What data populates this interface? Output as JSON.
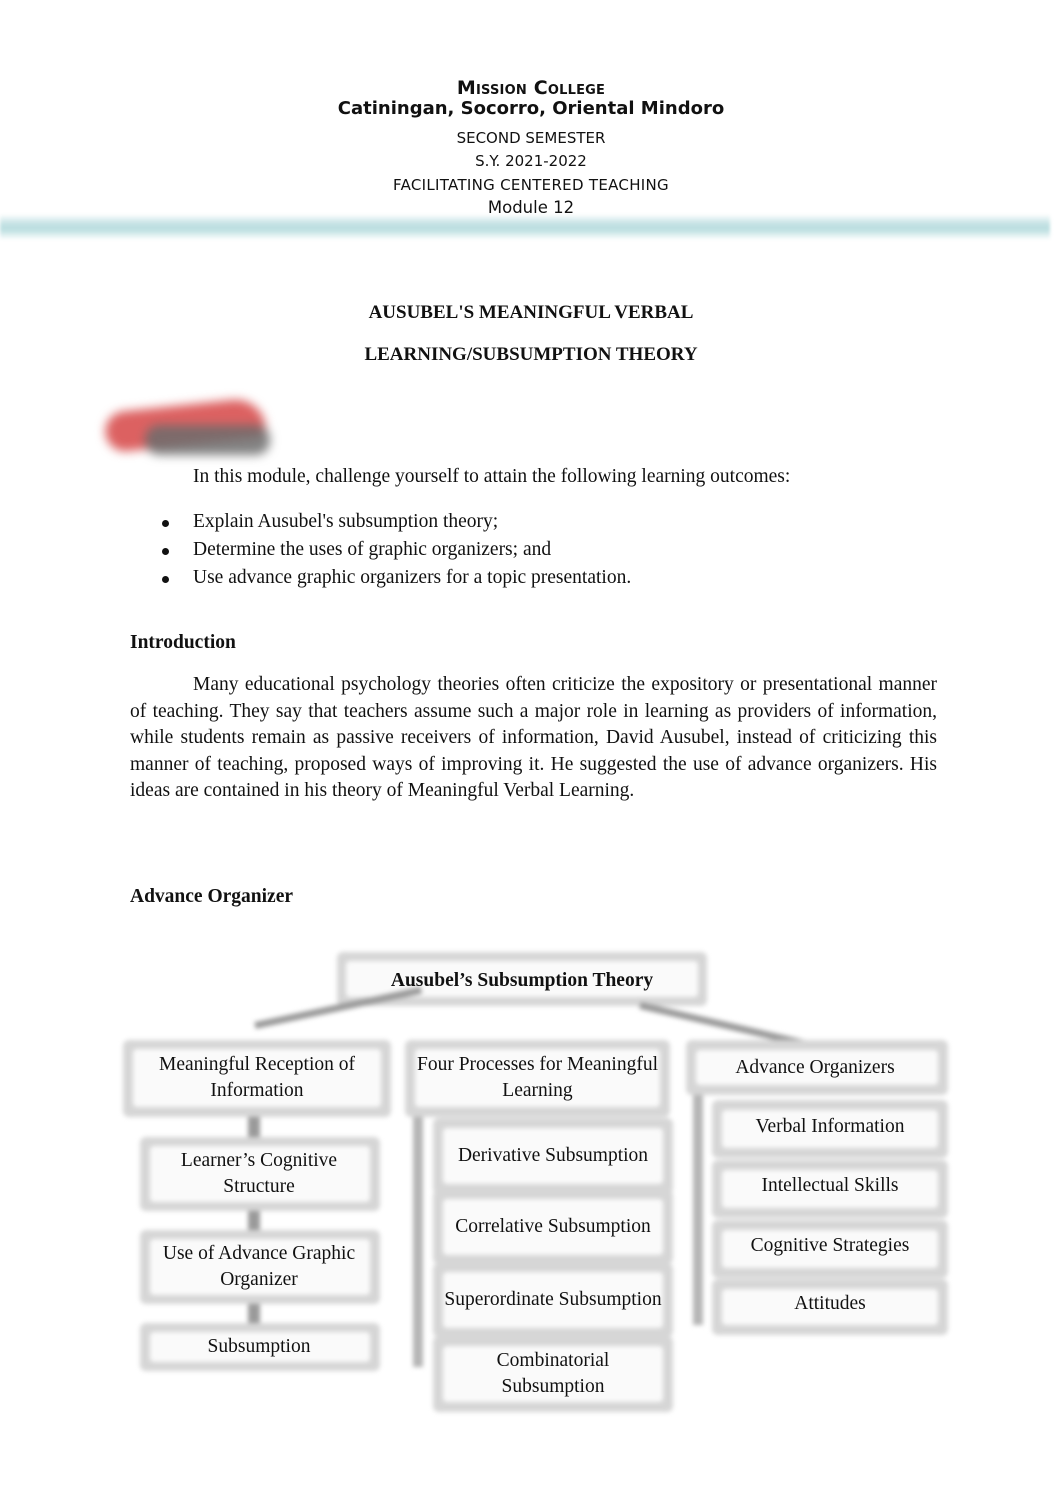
{
  "header": {
    "college": "Mission College",
    "address": "Catiningan, Socorro, Oriental Mindoro",
    "semester": "SECOND SEMESTER",
    "school_year": "S.Y. 2021-2022",
    "course": "FACILITATING CENTERED TEACHING",
    "module": "Module 12",
    "band_color": "#bfe0e2"
  },
  "title": {
    "line1": "AUSUBEL'S MEANINGFUL VERBAL",
    "line2": "LEARNING/SUBSUMPTION THEORY"
  },
  "logo_icon": "red-gray-decorative-logo",
  "objectives": {
    "intro": "In this module, challenge yourself to attain the following learning outcomes:",
    "items": [
      "Explain Ausubel's subsumption theory;",
      "Determine the uses of graphic organizers; and",
      "Use advance graphic organizers for a topic presentation."
    ]
  },
  "introduction": {
    "heading": "Introduction",
    "body": "Many educational psychology theories often criticize the expository or presentational manner of teaching. They say that teachers assume such a major role in learning as providers of information, while students remain as passive receivers of information, David Ausubel, instead of criticizing this manner of teaching, proposed ways of improving it. He suggested the use of advance organizers. His ideas are contained in his theory of Meaningful Verbal Learning."
  },
  "advance_organizer": {
    "heading": "Advance Organizer",
    "diagram": {
      "root": "Ausubel’s Subsumption Theory",
      "branches": [
        {
          "label": "Meaningful Reception of Information",
          "children": [
            "Learner’s Cognitive Structure",
            "Use of Advance Graphic Organizer",
            "Subsumption"
          ]
        },
        {
          "label": "Four Processes for Meaningful Learning",
          "children": [
            "Derivative Subsumption",
            "Correlative Subsumption",
            "Superordinate Subsumption",
            "Combinatorial Subsumption"
          ]
        },
        {
          "label": "Advance Organizers",
          "children": [
            "Verbal Information",
            "Intellectual Skills",
            "Cognitive Strategies",
            "Attitudes"
          ]
        }
      ]
    }
  }
}
